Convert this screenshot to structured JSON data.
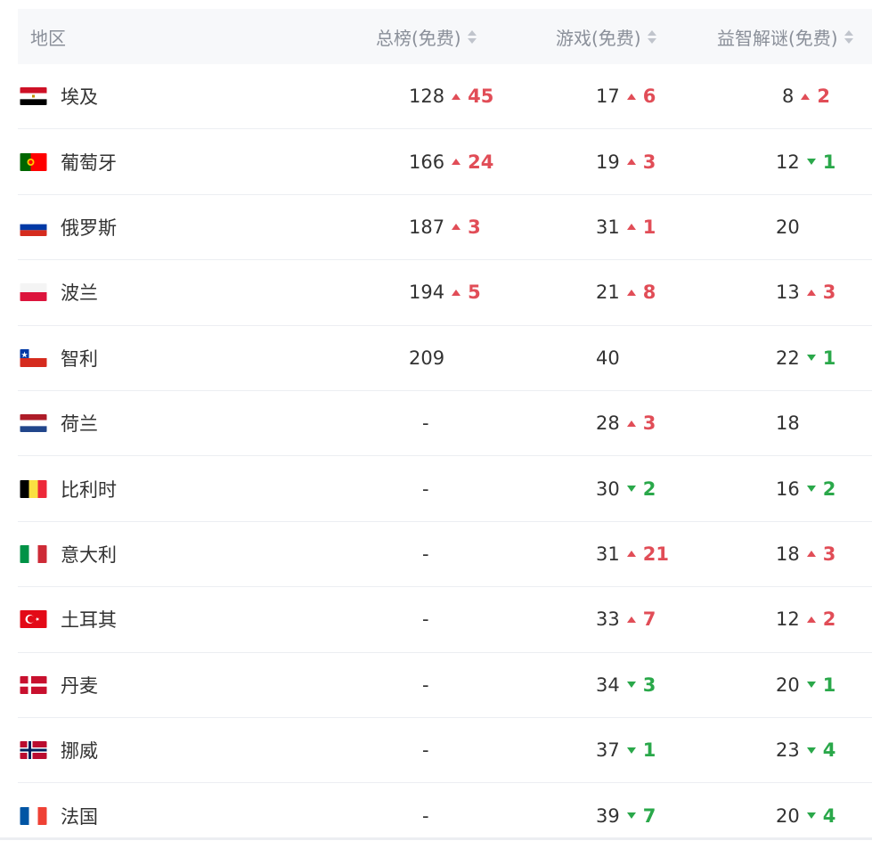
{
  "header": {
    "region": "地区",
    "overall": "总榜(免费)",
    "games": "游戏(免费)",
    "puzzle": "益智解谜(免费)"
  },
  "colors": {
    "up": "#e14d57",
    "down": "#2aa84a",
    "header_bg": "#f7f8fa"
  },
  "rows": [
    {
      "flag": "egypt",
      "region": "埃及",
      "overall": "128",
      "overall_dir": "up",
      "overall_delta": "45",
      "games": "17",
      "games_dir": "up",
      "games_delta": "6",
      "puzzle": "8",
      "puzzle_dir": "up",
      "puzzle_delta": "2"
    },
    {
      "flag": "portugal",
      "region": "葡萄牙",
      "overall": "166",
      "overall_dir": "up",
      "overall_delta": "24",
      "games": "19",
      "games_dir": "up",
      "games_delta": "3",
      "puzzle": "12",
      "puzzle_dir": "down",
      "puzzle_delta": "1"
    },
    {
      "flag": "russia",
      "region": "俄罗斯",
      "overall": "187",
      "overall_dir": "up",
      "overall_delta": "3",
      "games": "31",
      "games_dir": "up",
      "games_delta": "1",
      "puzzle": "20",
      "puzzle_dir": "",
      "puzzle_delta": ""
    },
    {
      "flag": "poland",
      "region": "波兰",
      "overall": "194",
      "overall_dir": "up",
      "overall_delta": "5",
      "games": "21",
      "games_dir": "up",
      "games_delta": "8",
      "puzzle": "13",
      "puzzle_dir": "up",
      "puzzle_delta": "3"
    },
    {
      "flag": "chile",
      "region": "智利",
      "overall": "209",
      "overall_dir": "",
      "overall_delta": "",
      "games": "40",
      "games_dir": "",
      "games_delta": "",
      "puzzle": "22",
      "puzzle_dir": "down",
      "puzzle_delta": "1"
    },
    {
      "flag": "netherlands",
      "region": "荷兰",
      "overall": "-",
      "overall_dir": "",
      "overall_delta": "",
      "games": "28",
      "games_dir": "up",
      "games_delta": "3",
      "puzzle": "18",
      "puzzle_dir": "",
      "puzzle_delta": ""
    },
    {
      "flag": "belgium",
      "region": "比利时",
      "overall": "-",
      "overall_dir": "",
      "overall_delta": "",
      "games": "30",
      "games_dir": "down",
      "games_delta": "2",
      "puzzle": "16",
      "puzzle_dir": "down",
      "puzzle_delta": "2"
    },
    {
      "flag": "italy",
      "region": "意大利",
      "overall": "-",
      "overall_dir": "",
      "overall_delta": "",
      "games": "31",
      "games_dir": "up",
      "games_delta": "21",
      "puzzle": "18",
      "puzzle_dir": "up",
      "puzzle_delta": "3"
    },
    {
      "flag": "turkey",
      "region": "土耳其",
      "overall": "-",
      "overall_dir": "",
      "overall_delta": "",
      "games": "33",
      "games_dir": "up",
      "games_delta": "7",
      "puzzle": "12",
      "puzzle_dir": "up",
      "puzzle_delta": "2"
    },
    {
      "flag": "denmark",
      "region": "丹麦",
      "overall": "-",
      "overall_dir": "",
      "overall_delta": "",
      "games": "34",
      "games_dir": "down",
      "games_delta": "3",
      "puzzle": "20",
      "puzzle_dir": "down",
      "puzzle_delta": "1"
    },
    {
      "flag": "norway",
      "region": "挪威",
      "overall": "-",
      "overall_dir": "",
      "overall_delta": "",
      "games": "37",
      "games_dir": "down",
      "games_delta": "1",
      "puzzle": "23",
      "puzzle_dir": "down",
      "puzzle_delta": "4"
    },
    {
      "flag": "france",
      "region": "法国",
      "overall": "-",
      "overall_dir": "",
      "overall_delta": "",
      "games": "39",
      "games_dir": "down",
      "games_delta": "7",
      "puzzle": "20",
      "puzzle_dir": "down",
      "puzzle_delta": "4"
    }
  ]
}
